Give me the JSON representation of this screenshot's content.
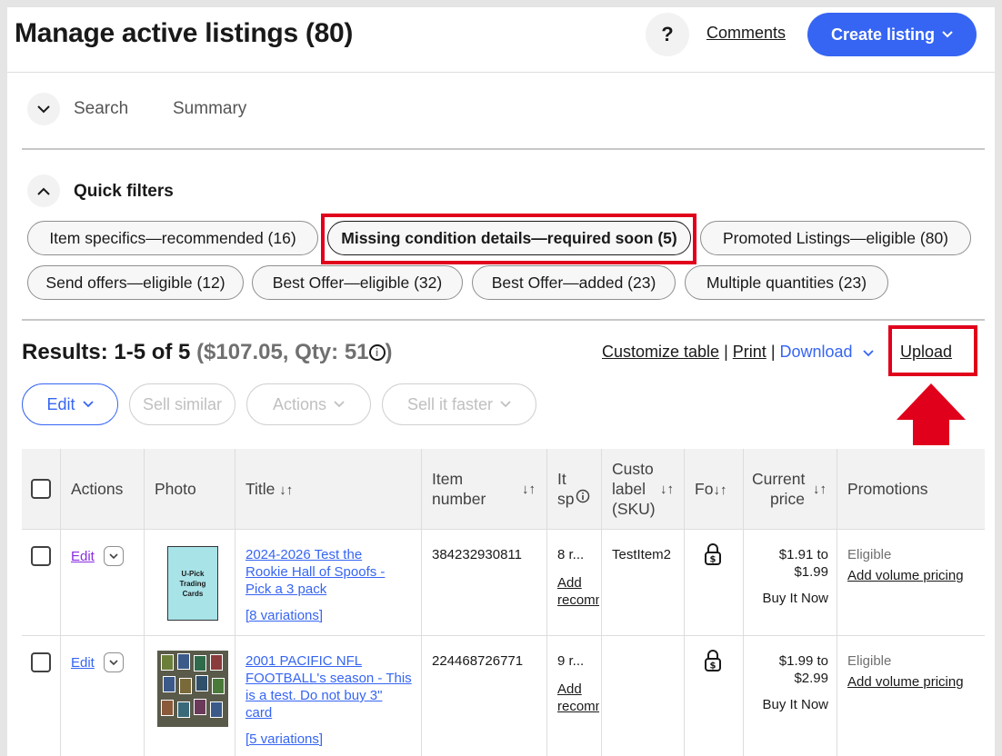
{
  "header": {
    "title": "Manage active listings (80)",
    "help_label": "?",
    "comments_label": "Comments",
    "create_label": "Create listing"
  },
  "search_bar": {
    "search_label": "Search",
    "summary_label": "Summary"
  },
  "quick_filters": {
    "title": "Quick filters",
    "chips": [
      "Item specifics—recommended (16)",
      "Missing condition details—required soon (5)",
      "Promoted Listings—eligible (80)",
      "Send offers—eligible (12)",
      "Best Offer—eligible (32)",
      "Best Offer—added (23)",
      "Multiple quantities (23)"
    ],
    "selected_index": 1
  },
  "results": {
    "count_text": "Results: 1-5 of 5",
    "summary_text": "($107.05, Qty: 51",
    "summary_close": ")",
    "info_icon": "i"
  },
  "table_links": {
    "customize": "Customize table",
    "sep": "|",
    "print": "Print",
    "download": "Download",
    "upload": "Upload"
  },
  "toolbar": {
    "edit": "Edit",
    "sell_similar": "Sell similar",
    "actions": "Actions",
    "sell_faster": "Sell it faster"
  },
  "columns": {
    "actions": "Actions",
    "photo": "Photo",
    "title": "Title",
    "item_number_1": "Item",
    "item_number_2": "number",
    "specifics_1": "It",
    "specifics_2": "sp",
    "sku_1": "Custo",
    "sku_2": "label",
    "sku_3": "(SKU)",
    "format": "Fo",
    "price_1": "Current",
    "price_2": "price",
    "promotions": "Promotions"
  },
  "rows": [
    {
      "edit": "Edit",
      "thumb_text_1": "U-Pick",
      "thumb_text_2": "Trading",
      "thumb_text_3": "Cards",
      "title_1": "2024-2026 Test the",
      "title_2": "Rookie Hall of Spoofs -",
      "title_3": "Pick a 3 pack",
      "title_4": "",
      "variations": "[8 variations]",
      "item_number": "384232930811",
      "specifics": "8 r...",
      "specifics_link_1": "Add",
      "specifics_link_2": "recomm",
      "sku": "TestItem2",
      "price_1": "$1.91 to",
      "price_2": "$1.99",
      "price_format": "Buy It Now",
      "promo_status": "Eligible",
      "promo_link": "Add volume pricing"
    },
    {
      "edit": "Edit",
      "title_1": "2001 PACIFIC NFL",
      "title_2": "FOOTBALL's season - This",
      "title_3": "is a test. Do not buy 3\"",
      "title_4": "card",
      "variations": "[5 variations]",
      "item_number": "224468726771",
      "specifics": "9 r...",
      "specifics_link_1": "Add",
      "specifics_link_2": "recomm",
      "sku": "",
      "price_1": "$1.99 to",
      "price_2": "$2.99",
      "price_format": "Buy It Now",
      "promo_status": "Eligible",
      "promo_link": "Add volume pricing"
    }
  ],
  "icons": {
    "chevron": "chevron-down-icon",
    "chevron_up": "chevron-up-icon",
    "lock": "lock-dollar-icon",
    "sort": "sort-icon",
    "arrow": "red-up-arrow"
  },
  "colors": {
    "accent": "#3665f3",
    "highlight": "#e0001b"
  }
}
